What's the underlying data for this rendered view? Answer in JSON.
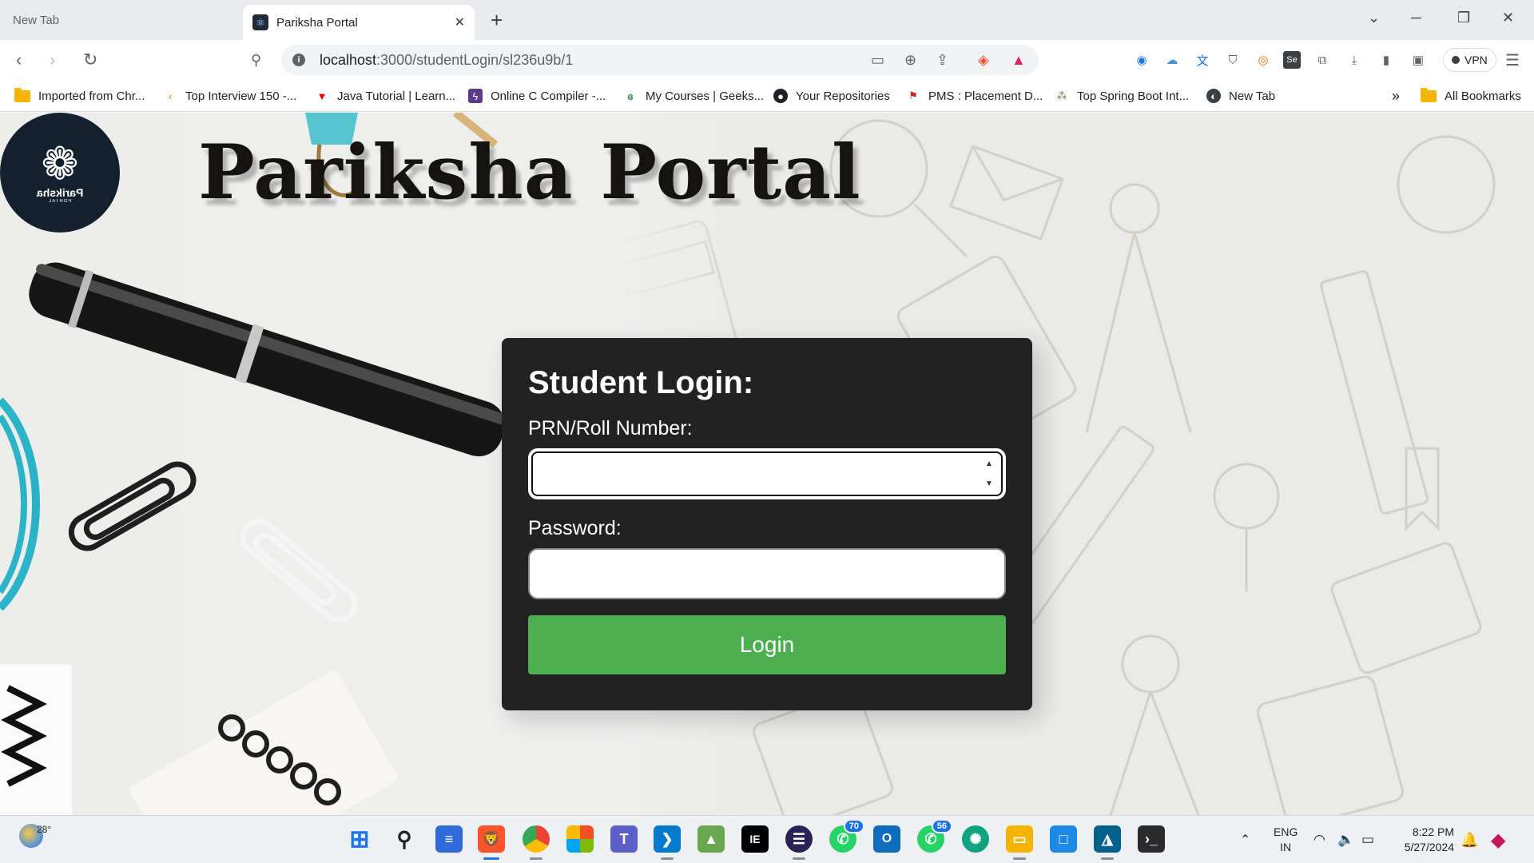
{
  "browser": {
    "tabs": [
      {
        "title": "New Tab",
        "active": false
      },
      {
        "title": "Pariksha Portal",
        "active": true
      }
    ],
    "new_tab_symbol": "+",
    "url_host": "localhost",
    "url_path": ":3000/studentLogin/sl236u9b/1",
    "vpn_label": "VPN",
    "bookmarks": [
      {
        "label": "Imported from Chr...",
        "icon": "folder-icon"
      },
      {
        "label": "Top Interview 150 -...",
        "icon": "leetcode-icon"
      },
      {
        "label": "Java Tutorial | Learn...",
        "icon": "javatpoint-icon"
      },
      {
        "label": "Online C Compiler -...",
        "icon": "compiler-icon"
      },
      {
        "label": "My Courses | Geeks...",
        "icon": "geeksforgeeks-icon"
      },
      {
        "label": "Your Repositories",
        "icon": "github-icon"
      },
      {
        "label": "PMS : Placement D...",
        "icon": "pms-icon"
      },
      {
        "label": "Top Spring Boot Int...",
        "icon": "spring-icon"
      },
      {
        "label": "New Tab",
        "icon": "globe-icon"
      }
    ],
    "bookmarks_overflow": "»",
    "all_bookmarks_label": "All Bookmarks"
  },
  "page": {
    "logo_text": "Pariksha",
    "logo_subtext": "PORTAL",
    "site_title": "Pariksha Portal",
    "login": {
      "heading": "Student Login:",
      "prn_label": "PRN/Roll Number:",
      "prn_value": "",
      "password_label": "Password:",
      "password_value": "",
      "button_label": "Login"
    }
  },
  "taskbar": {
    "weather_temp": "28°",
    "apps": [
      {
        "name": "start-button",
        "color": "#1a73e8"
      },
      {
        "name": "search-button",
        "color": "#202124"
      },
      {
        "name": "notepad-app",
        "color": "#2f6bd8"
      },
      {
        "name": "brave-app",
        "color": "#fb542b"
      },
      {
        "name": "chrome-app",
        "color": "#34a853"
      },
      {
        "name": "office-app",
        "color": "#d83b01"
      },
      {
        "name": "teams-app",
        "color": "#5b5fc7"
      },
      {
        "name": "vscode-app",
        "color": "#007acc"
      },
      {
        "name": "image-app",
        "color": "#6aa84f"
      },
      {
        "name": "intellij-app",
        "color": "#000000"
      },
      {
        "name": "eclipse-app",
        "color": "#2c2255"
      },
      {
        "name": "whatsapp-app",
        "color": "#25d366",
        "badge": "70"
      },
      {
        "name": "outlook-app",
        "color": "#0f6cbd"
      },
      {
        "name": "whatsapp-beta-app",
        "color": "#25d366",
        "badge": "56"
      },
      {
        "name": "chatgpt-app",
        "color": "#10a37f"
      },
      {
        "name": "file-explorer-app",
        "color": "#f4b400"
      },
      {
        "name": "window-app",
        "color": "#1e88e5"
      },
      {
        "name": "mysql-app",
        "color": "#00618a"
      },
      {
        "name": "terminal-app",
        "color": "#2b2b2b"
      }
    ],
    "language_line1": "ENG",
    "language_line2": "IN",
    "time": "8:22 PM",
    "date": "5/27/2024"
  },
  "colors": {
    "card_bg": "#222222",
    "login_button": "#4caf50",
    "logo_bg": "#13202e"
  }
}
